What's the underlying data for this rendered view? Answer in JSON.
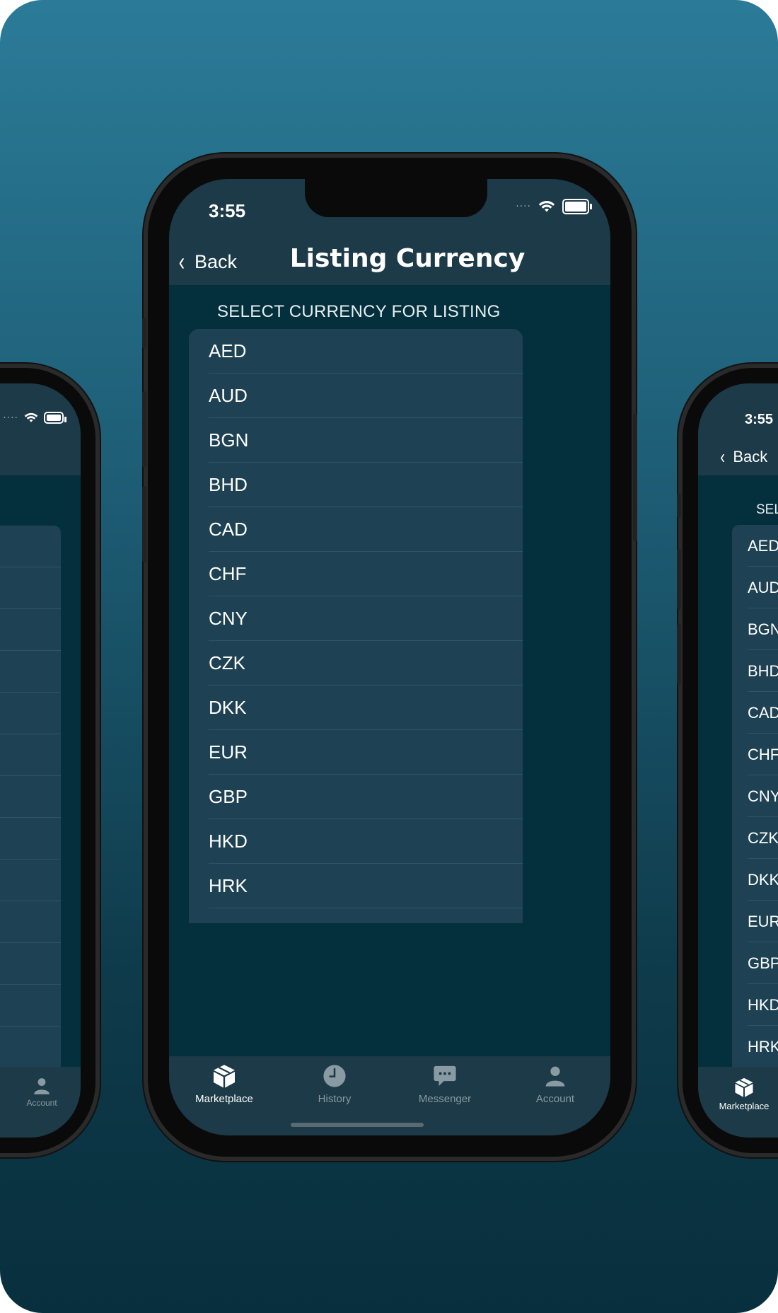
{
  "status_bar": {
    "time": "3:55",
    "signal": "····"
  },
  "nav": {
    "back_label": "Back",
    "title": "Listing Currency"
  },
  "section": {
    "header": "SELECT CURRENCY FOR LISTING"
  },
  "currencies": [
    "AED",
    "AUD",
    "BGN",
    "BHD",
    "CAD",
    "CHF",
    "CNY",
    "CZK",
    "DKK",
    "EUR",
    "GBP",
    "HKD",
    "HRK"
  ],
  "tabs": [
    {
      "label": "Marketplace",
      "icon": "box-icon",
      "active": true
    },
    {
      "label": "History",
      "icon": "clock-icon",
      "active": false
    },
    {
      "label": "Messenger",
      "icon": "chat-bubble-icon",
      "active": false
    },
    {
      "label": "Account",
      "icon": "person-icon",
      "active": false
    }
  ],
  "right_phone": {
    "time": "3:55",
    "back_label": "Back",
    "section_header": "SELEC",
    "tab_label": "Marketplace"
  },
  "left_phone": {
    "tab_label": "Account"
  },
  "colors": {
    "background_top": "#2b7b98",
    "background_bottom": "#082f3d",
    "bar": "#1c3a47",
    "list": "#1e4253",
    "screen": "#04303e",
    "inactive_tab": "#8a9aa2"
  }
}
